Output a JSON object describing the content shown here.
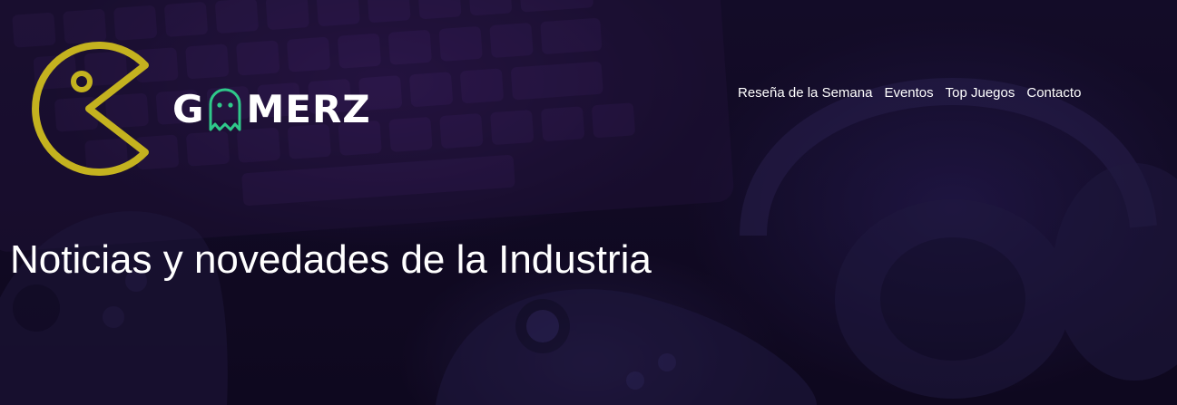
{
  "header": {
    "logo_text_before": "G",
    "logo_text_after": "MERZ",
    "pacman_icon": "pacman-logo-icon",
    "ghost_icon": "ghost-icon",
    "colors": {
      "pacman": "#c4b21f",
      "ghost": "#2fc98a"
    }
  },
  "nav": {
    "items": [
      {
        "label": "Reseña de la Semana"
      },
      {
        "label": "Eventos"
      },
      {
        "label": "Top Juegos"
      },
      {
        "label": "Contacto"
      }
    ]
  },
  "hero": {
    "title": "Noticias y novedades de la Industria",
    "background_image": "gaming-keyboard-controllers-headphones"
  }
}
